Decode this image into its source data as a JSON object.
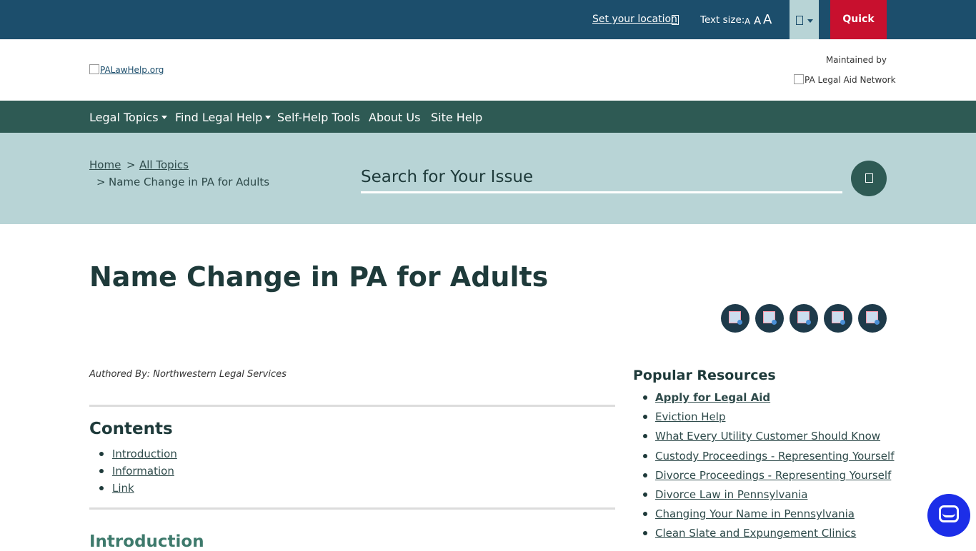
{
  "topbar": {
    "location_link": "Set your location",
    "text_size_label": "Text size:",
    "text_size_options": [
      "A",
      "A",
      "A"
    ],
    "quick_exit": "Quick Exit",
    "colors": {
      "background": "#1c4e6c",
      "quick_exit": "#c8102e",
      "language": "#b8d4d6"
    }
  },
  "header": {
    "logo_alt": "PALawHelp.org",
    "maintained_by": "Maintained by",
    "partner_alt": "PA Legal Aid Network"
  },
  "nav": {
    "items": [
      {
        "label": "Legal Topics",
        "dropdown": true
      },
      {
        "label": "Find Legal Help",
        "dropdown": true
      },
      {
        "label": "Self-Help Tools",
        "dropdown": false
      },
      {
        "label": "About Us",
        "dropdown": false
      },
      {
        "label": "Site Help",
        "dropdown": false
      }
    ],
    "color": "#2e5a54"
  },
  "breadcrumb": {
    "home": "Home",
    "separator": ">",
    "all_topics": "All Topics",
    "current": "Name Change in PA for Adults"
  },
  "search": {
    "placeholder": "Search for Your Issue"
  },
  "main": {
    "title": "Name Change in PA for Adults",
    "share_icons": [
      "facebook-icon",
      "twitter-icon",
      "email-icon",
      "print-icon",
      "link-icon"
    ],
    "author": "Authored By: Northwestern Legal Services",
    "contents_heading": "Contents",
    "contents": [
      "Introduction",
      "Information",
      "Link"
    ],
    "intro_heading": "Introduction"
  },
  "sidebar": {
    "heading": "Popular Resources",
    "items": [
      {
        "label": "Apply for Legal Aid",
        "bold": true
      },
      {
        "label": "Eviction Help",
        "bold": false
      },
      {
        "label": "What Every Utility Customer Should Know",
        "bold": false
      },
      {
        "label": "Custody Proceedings - Representing Yourself",
        "bold": false
      },
      {
        "label": "Divorce Proceedings - Representing Yourself",
        "bold": false
      },
      {
        "label": "Divorce Law in Pennsylvania",
        "bold": false
      },
      {
        "label": "Changing Your Name in Pennsylvania",
        "bold": false
      },
      {
        "label": "Clean Slate and Expungement Clinics",
        "bold": false
      }
    ]
  },
  "chat": {
    "icon": "chat-icon",
    "color": "#1c2ee8"
  }
}
